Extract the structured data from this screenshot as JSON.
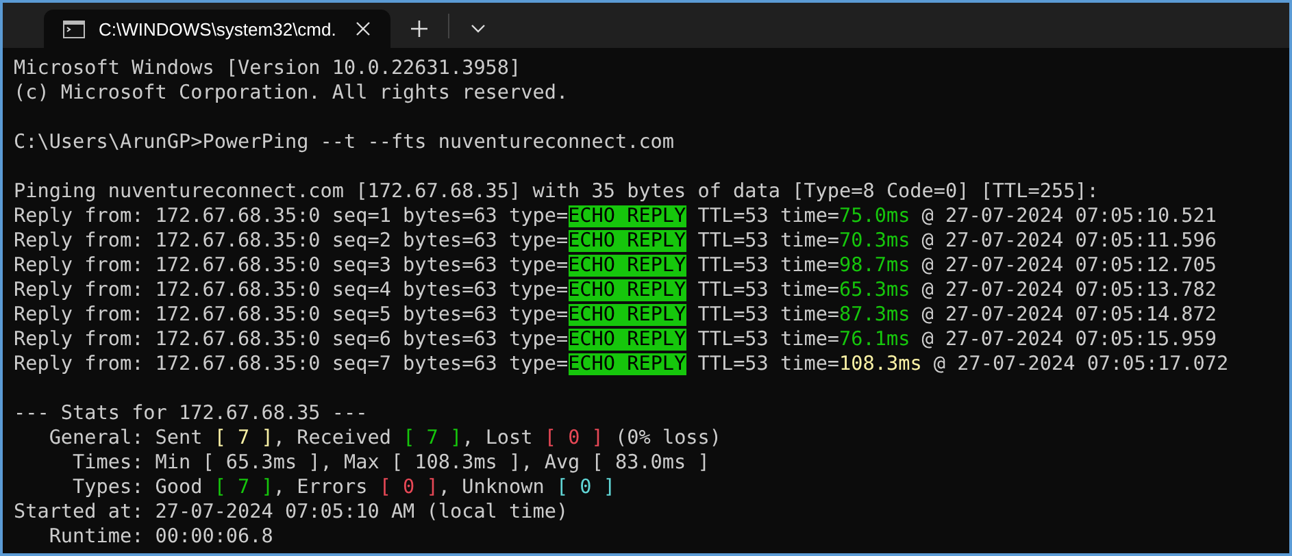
{
  "window": {
    "tab": {
      "title": "C:\\WINDOWS\\system32\\cmd.",
      "selected": true
    }
  },
  "blocks": [
    {
      "lines": [
        [
          {
            "text": "Microsoft Windows [Version 10.0.22631.3958]",
            "kind": "plain"
          }
        ],
        [
          {
            "text": "(c) Microsoft Corporation. All rights reserved.",
            "kind": "plain"
          }
        ]
      ]
    },
    {
      "lines": [
        [
          {
            "text": "C:\\Users\\ArunGP>PowerPing --t --fts nuventureconnect.com",
            "kind": "plain"
          }
        ]
      ]
    },
    {
      "lines": [
        [
          {
            "text": "Pinging nuventureconnect.com [172.67.68.35] with 35 bytes of data [Type=8 Code=0] [TTL=255]:",
            "kind": "plain"
          }
        ],
        [
          {
            "text": "Reply from: 172.67.68.35:0 seq=1 bytes=63 type=",
            "kind": "plain"
          },
          {
            "text": "ECHO REPLY",
            "kind": "badge"
          },
          {
            "text": " TTL=53 time=",
            "kind": "plain"
          },
          {
            "text": "75.0ms",
            "kind": "good"
          },
          {
            "text": " @ 27-07-2024 07:05:10.521",
            "kind": "plain"
          }
        ],
        [
          {
            "text": "Reply from: 172.67.68.35:0 seq=2 bytes=63 type=",
            "kind": "plain"
          },
          {
            "text": "ECHO REPLY",
            "kind": "badge"
          },
          {
            "text": " TTL=53 time=",
            "kind": "plain"
          },
          {
            "text": "70.3ms",
            "kind": "good"
          },
          {
            "text": " @ 27-07-2024 07:05:11.596",
            "kind": "plain"
          }
        ],
        [
          {
            "text": "Reply from: 172.67.68.35:0 seq=3 bytes=63 type=",
            "kind": "plain"
          },
          {
            "text": "ECHO REPLY",
            "kind": "badge"
          },
          {
            "text": " TTL=53 time=",
            "kind": "plain"
          },
          {
            "text": "98.7ms",
            "kind": "good"
          },
          {
            "text": " @ 27-07-2024 07:05:12.705",
            "kind": "plain"
          }
        ],
        [
          {
            "text": "Reply from: 172.67.68.35:0 seq=4 bytes=63 type=",
            "kind": "plain"
          },
          {
            "text": "ECHO REPLY",
            "kind": "badge"
          },
          {
            "text": " TTL=53 time=",
            "kind": "plain"
          },
          {
            "text": "65.3ms",
            "kind": "good"
          },
          {
            "text": " @ 27-07-2024 07:05:13.782",
            "kind": "plain"
          }
        ],
        [
          {
            "text": "Reply from: 172.67.68.35:0 seq=5 bytes=63 type=",
            "kind": "plain"
          },
          {
            "text": "ECHO REPLY",
            "kind": "badge"
          },
          {
            "text": " TTL=53 time=",
            "kind": "plain"
          },
          {
            "text": "87.3ms",
            "kind": "good"
          },
          {
            "text": " @ 27-07-2024 07:05:14.872",
            "kind": "plain"
          }
        ],
        [
          {
            "text": "Reply from: 172.67.68.35:0 seq=6 bytes=63 type=",
            "kind": "plain"
          },
          {
            "text": "ECHO REPLY",
            "kind": "badge"
          },
          {
            "text": " TTL=53 time=",
            "kind": "plain"
          },
          {
            "text": "76.1ms",
            "kind": "good"
          },
          {
            "text": " @ 27-07-2024 07:05:15.959",
            "kind": "plain"
          }
        ],
        [
          {
            "text": "Reply from: 172.67.68.35:0 seq=7 bytes=63 type=",
            "kind": "plain"
          },
          {
            "text": "ECHO REPLY",
            "kind": "badge"
          },
          {
            "text": " TTL=53 time=",
            "kind": "plain"
          },
          {
            "text": "108.3ms",
            "kind": "warn"
          },
          {
            "text": " @ 27-07-2024 07:05:17.072",
            "kind": "plain"
          }
        ]
      ]
    },
    {
      "lines": [
        [
          {
            "text": "--- Stats for 172.67.68.35 ---",
            "kind": "plain"
          }
        ],
        [
          {
            "text": "   General: Sent ",
            "kind": "plain"
          },
          {
            "text": "[ 7 ]",
            "kind": "warn"
          },
          {
            "text": ", Received ",
            "kind": "plain"
          },
          {
            "text": "[ 7 ]",
            "kind": "good"
          },
          {
            "text": ", Lost ",
            "kind": "plain"
          },
          {
            "text": "[ 0 ]",
            "kind": "bad"
          },
          {
            "text": " (0% loss)",
            "kind": "plain"
          }
        ],
        [
          {
            "text": "     Times: Min [ 65.3ms ], Max [ 108.3ms ], Avg [ 83.0ms ]",
            "kind": "plain"
          }
        ],
        [
          {
            "text": "     Types: Good ",
            "kind": "plain"
          },
          {
            "text": "[ 7 ]",
            "kind": "good"
          },
          {
            "text": ", Errors ",
            "kind": "plain"
          },
          {
            "text": "[ 0 ]",
            "kind": "bad"
          },
          {
            "text": ", Unknown ",
            "kind": "plain"
          },
          {
            "text": "[ 0 ]",
            "kind": "info"
          }
        ],
        [
          {
            "text": "Started at: 27-07-2024 07:05:10 AM (local time)",
            "kind": "plain"
          }
        ],
        [
          {
            "text": "   Runtime: 00:00:06.8",
            "kind": "plain"
          }
        ]
      ]
    }
  ]
}
